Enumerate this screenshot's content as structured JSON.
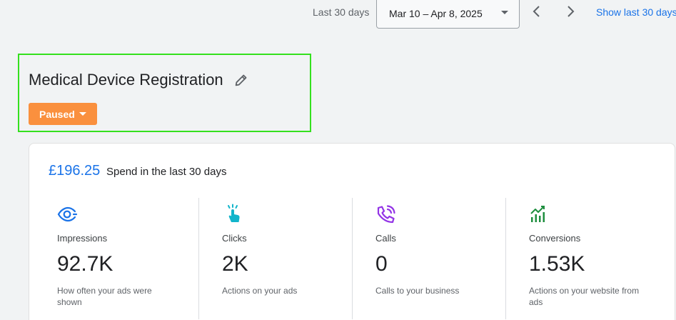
{
  "toolbar": {
    "range_label": "Last 30 days",
    "date_range": "Mar 10 – Apr 8, 2025",
    "show_link": "Show last 30 days"
  },
  "campaign": {
    "title": "Medical Device Registration",
    "status": "Paused"
  },
  "summary": {
    "spend_amount": "£196.25",
    "spend_label": "Spend in the last 30 days"
  },
  "metrics": [
    {
      "label": "Impressions",
      "value": "92.7K",
      "description": "How often your ads were shown",
      "icon": "eye-icon",
      "color": "#1a73e8"
    },
    {
      "label": "Clicks",
      "value": "2K",
      "description": "Actions on your ads",
      "icon": "tap-icon",
      "color": "#12b5cb"
    },
    {
      "label": "Calls",
      "value": "0",
      "description": "Calls to your business",
      "icon": "phone-icon",
      "color": "#9334e6"
    },
    {
      "label": "Conversions",
      "value": "1.53K",
      "description": "Actions on your website from ads",
      "icon": "trending-icon",
      "color": "#1e8e3e"
    }
  ],
  "colors": {
    "accent": "#1a73e8",
    "paused": "#fa903e",
    "highlight": "#34e01e"
  }
}
